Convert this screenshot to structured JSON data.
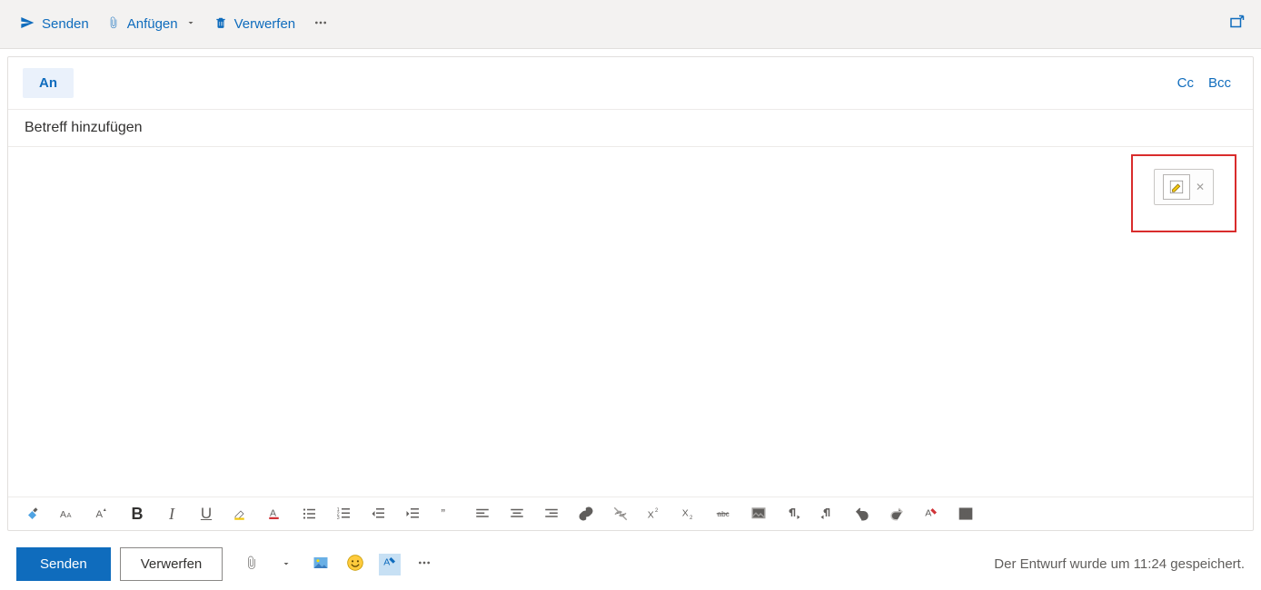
{
  "top": {
    "send": "Senden",
    "attach": "Anfügen",
    "discard": "Verwerfen"
  },
  "to": {
    "label": "An",
    "cc": "Cc",
    "bcc": "Bcc"
  },
  "subject": {
    "placeholder": "Betreff hinzufügen",
    "value": ""
  },
  "body": {
    "value": ""
  },
  "bottom": {
    "send": "Senden",
    "discard": "Verwerfen",
    "status": "Der Entwurf wurde um 11:24 gespeichert."
  }
}
